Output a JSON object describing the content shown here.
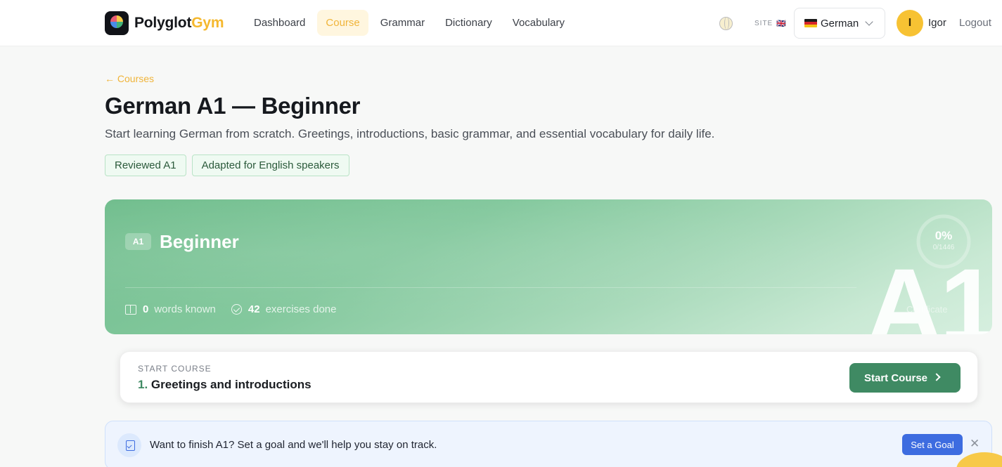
{
  "app": {
    "brand_main": "Polyglot",
    "brand_accent": "Gym",
    "accent_color": "#f0b43a",
    "primary_green": "#3f8a63"
  },
  "nav": {
    "items": [
      {
        "label": "Dashboard",
        "active": false
      },
      {
        "label": "Course",
        "active": true
      },
      {
        "label": "Grammar",
        "active": false
      },
      {
        "label": "Dictionary",
        "active": false
      },
      {
        "label": "Vocabulary",
        "active": false
      }
    ]
  },
  "header": {
    "site_label": "SITE",
    "site_flag": "🇬🇧",
    "language_select": {
      "selected": "German"
    },
    "user": {
      "initial": "I",
      "name": "Igor"
    },
    "logout_label": "Logout"
  },
  "course": {
    "back_link": "← Courses",
    "title": "German A1 — Beginner",
    "subtitle": "Start learning German from scratch. Greetings, introductions, basic grammar, and essential vocabulary for daily life.",
    "tags": [
      "Reviewed A1",
      "Adapted for English speakers"
    ]
  },
  "level": {
    "code": "A1",
    "name": "Beginner",
    "progress_percent": "0%",
    "progress_fraction": 0,
    "progress_count": "0/1446",
    "big_code": "A1",
    "certificate_label": "Certificate",
    "stats": {
      "words_known_value": "0",
      "words_known_label": "words known",
      "exercises_done_value": "42",
      "exercises_done_label": "exercises done"
    }
  },
  "start": {
    "overline": "START COURSE",
    "lesson_number": "1.",
    "lesson_title": "Greetings and introductions",
    "button_label": "Start Course"
  },
  "goal_banner": {
    "text": "Want to finish A1? Set a goal and we'll help you stay on track.",
    "button_label": "Set a Goal",
    "close_symbol": "✕"
  }
}
